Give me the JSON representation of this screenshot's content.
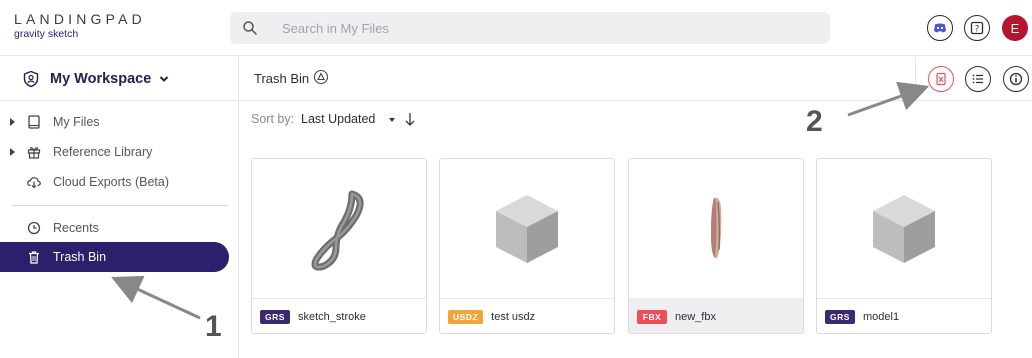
{
  "logo": {
    "title": "LANDINGPAD",
    "subtitle": "gravity sketch"
  },
  "search": {
    "placeholder": "Search in My Files"
  },
  "topbar": {
    "avatar_letter": "E"
  },
  "sidebar": {
    "workspace_label": "My Workspace",
    "items": [
      {
        "label": "My Files"
      },
      {
        "label": "Reference Library"
      },
      {
        "label": "Cloud Exports (Beta)"
      },
      {
        "label": "Recents"
      },
      {
        "label": "Trash Bin"
      }
    ]
  },
  "main": {
    "breadcrumb": "Trash Bin",
    "sort_label": "Sort by:",
    "sort_value": "Last Updated"
  },
  "files": [
    {
      "type": "GRS",
      "name": "sketch_stroke",
      "badge_color": "#3b2a73"
    },
    {
      "type": "USDZ",
      "name": "test usdz",
      "badge_color": "#f2a53a"
    },
    {
      "type": "FBX",
      "name": "new_fbx",
      "badge_color": "#ec4f5a"
    },
    {
      "type": "GRS",
      "name": "model1",
      "badge_color": "#3b2a73"
    }
  ],
  "annotations": {
    "one": "1",
    "two": "2"
  },
  "colors": {
    "accent": "#2c1f6b",
    "avatar": "#b5152f",
    "trash_button": "#e8525c"
  }
}
